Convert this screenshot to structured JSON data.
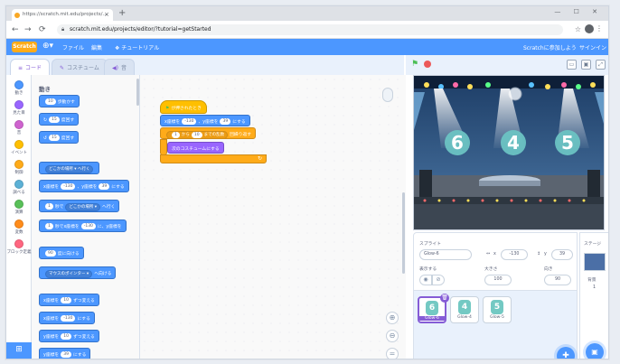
{
  "browser": {
    "tab_title": "https://scratch.mit.edu/projects/...",
    "url": "scratch.mit.edu/projects/editor/?tutorial=getStarted"
  },
  "menubar": {
    "logo": "Scratch",
    "file": "ファイル",
    "edit": "編集",
    "tutorials": "チュートリアル",
    "join": "Scratchに参加しよう",
    "signin": "サインイン"
  },
  "tabs": {
    "code": "コード",
    "costumes": "コスチューム",
    "sounds": "音"
  },
  "categories": [
    {
      "label": "動き",
      "color": "#4c97ff"
    },
    {
      "label": "見た目",
      "color": "#9966ff"
    },
    {
      "label": "音",
      "color": "#cf63cf"
    },
    {
      "label": "イベント",
      "color": "#ffbf00"
    },
    {
      "label": "制御",
      "color": "#ffab19"
    },
    {
      "label": "調べる",
      "color": "#5cb1d6"
    },
    {
      "label": "演算",
      "color": "#59c059"
    },
    {
      "label": "変数",
      "color": "#ff8c1a"
    },
    {
      "label": "ブロック定義",
      "color": "#ff6680"
    }
  ],
  "palette": {
    "title": "動き",
    "b1": "10 歩動かす",
    "b1_n": "10",
    "b2_n": "15",
    "b2": "度回す",
    "b3_n": "15",
    "b3": "度回す",
    "b4": "どこかの場所 ▾ へ行く",
    "b5a": "x座標を",
    "b5_x": "-130",
    "b5b": "、y座標を",
    "b5_y": "39",
    "b5c": "にする",
    "b6a": "1",
    "b6b": "秒で",
    "b6c": "どこかの場所 ▾",
    "b6d": "へ行く",
    "b7a": "1",
    "b7b": "秒でx座標を",
    "b7c": "-130",
    "b7d": "に、y座標を",
    "b8a": "90",
    "b8b": "度に向ける",
    "b9a": "マウスのポインター ▾",
    "b9b": "へ向ける",
    "b10a": "x座標を",
    "b10b": "10",
    "b10c": "ずつ変える",
    "b11a": "x座標を",
    "b11b": "-130",
    "b11c": "にする",
    "b12a": "y座標を",
    "b12b": "10",
    "b12c": "ずつ変える",
    "b13a": "y座標を",
    "b13b": "39",
    "b13c": "にする"
  },
  "script": {
    "hat": "が押されたとき",
    "goto_a": "x座標を",
    "goto_x": "-130",
    "goto_b": "、y座標を",
    "goto_y": "39",
    "goto_c": "にする",
    "ctrl_a": "1",
    "ctrl_b": "から",
    "ctrl_c": "10",
    "ctrl_d": "までの乱数",
    "ctrl_e": "回繰り返す",
    "looks": "次のコスチュームにする"
  },
  "stage": {
    "digits": [
      "6",
      "4",
      "5"
    ]
  },
  "sprite": {
    "sprite_label": "スプライト",
    "name": "Glow-6",
    "x_label": "x",
    "x": "-130",
    "y_label": "y",
    "y": "39",
    "show_label": "表示する",
    "size_label": "大きさ",
    "size": "100",
    "dir_label": "向き",
    "dir": "90"
  },
  "sprites": [
    {
      "name": "Glow-6",
      "digit": "6"
    },
    {
      "name": "Glow-4",
      "digit": "4"
    },
    {
      "name": "Glow-5",
      "digit": "5"
    }
  ],
  "stagepane": {
    "label": "ステージ",
    "backdrops_label": "背景",
    "backdrops_count": "1"
  }
}
